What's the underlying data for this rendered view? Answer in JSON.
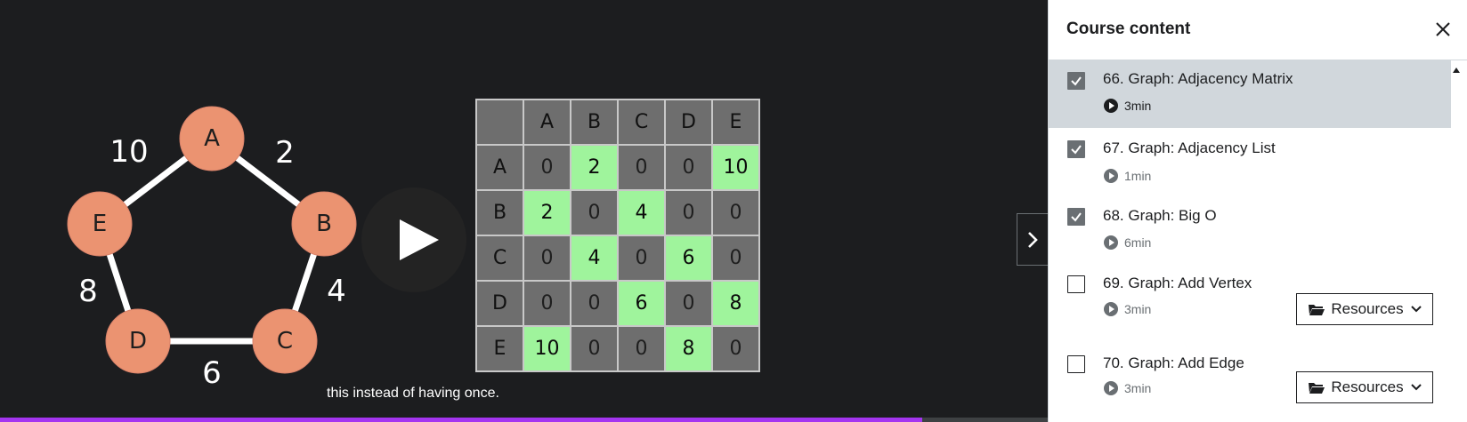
{
  "video": {
    "caption": "this instead of having once.",
    "progress_fraction": 0.88
  },
  "graph": {
    "nodes": [
      "A",
      "B",
      "C",
      "D",
      "E"
    ],
    "weights": {
      "A-B": "2",
      "B-C": "4",
      "C-D": "6",
      "D-E": "8",
      "E-A": "10"
    }
  },
  "matrix": {
    "headers": [
      "A",
      "B",
      "C",
      "D",
      "E"
    ],
    "rows": [
      {
        "label": "A",
        "cells": [
          "0",
          "2",
          "0",
          "0",
          "10"
        ],
        "highlight": [
          false,
          true,
          false,
          false,
          true
        ]
      },
      {
        "label": "B",
        "cells": [
          "2",
          "0",
          "4",
          "0",
          "0"
        ],
        "highlight": [
          true,
          false,
          true,
          false,
          false
        ]
      },
      {
        "label": "C",
        "cells": [
          "0",
          "4",
          "0",
          "6",
          "0"
        ],
        "highlight": [
          false,
          true,
          false,
          true,
          false
        ]
      },
      {
        "label": "D",
        "cells": [
          "0",
          "0",
          "6",
          "0",
          "8"
        ],
        "highlight": [
          false,
          false,
          true,
          false,
          true
        ]
      },
      {
        "label": "E",
        "cells": [
          "10",
          "0",
          "0",
          "8",
          "0"
        ],
        "highlight": [
          true,
          false,
          false,
          true,
          false
        ]
      }
    ]
  },
  "sidebar": {
    "title": "Course content",
    "lectures": [
      {
        "title": "66. Graph: Adjacency Matrix",
        "duration": "3min",
        "checked": true,
        "active": true,
        "resources": null
      },
      {
        "title": "67. Graph: Adjacency List",
        "duration": "1min",
        "checked": true,
        "active": false,
        "resources": null
      },
      {
        "title": "68. Graph: Big O",
        "duration": "6min",
        "checked": true,
        "active": false,
        "resources": null
      },
      {
        "title": "69. Graph: Add Vertex",
        "duration": "3min",
        "checked": false,
        "active": false,
        "resources": "Resources"
      },
      {
        "title": "70. Graph: Add Edge",
        "duration": "3min",
        "checked": false,
        "active": false,
        "resources": "Resources"
      }
    ]
  },
  "colors": {
    "accent_progress": "#a435f0",
    "node_fill": "#eb9371",
    "matrix_highlight": "#9ff49c",
    "active_lecture_bg": "#d1d7dc"
  }
}
